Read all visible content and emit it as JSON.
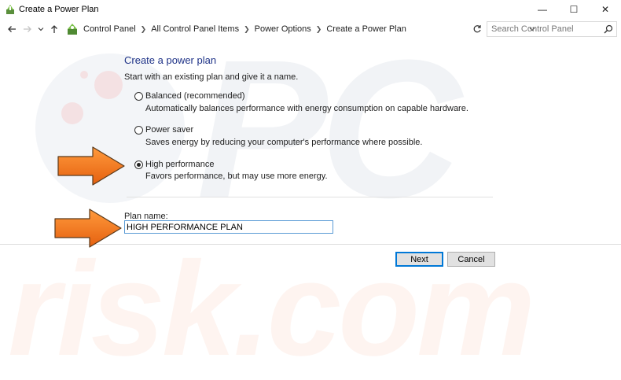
{
  "window": {
    "title": "Create a Power Plan",
    "controls": {
      "minimize": "—",
      "maximize": "☐",
      "close": "✕"
    }
  },
  "nav": {
    "back_icon": "arrow-left-icon",
    "forward_icon": "arrow-right-icon",
    "recent_icon": "chevron-down-icon",
    "up_icon": "arrow-up-icon",
    "breadcrumbs": [
      "Control Panel",
      "All Control Panel Items",
      "Power Options",
      "Create a Power Plan"
    ],
    "search_placeholder": "Search Control Panel"
  },
  "page": {
    "heading": "Create a power plan",
    "subtitle": "Start with an existing plan and give it a name.",
    "options": [
      {
        "label": "Balanced (recommended)",
        "description": "Automatically balances performance with energy consumption on capable hardware.",
        "checked": false
      },
      {
        "label": "Power saver",
        "description": "Saves energy by reducing your computer's performance where possible.",
        "checked": false
      },
      {
        "label": "High performance",
        "description": "Favors performance, but may use more energy.",
        "checked": true
      }
    ],
    "plan_name_label": "Plan name:",
    "plan_name_value": "HIGH PERFORMANCE PLAN",
    "next_label": "Next",
    "cancel_label": "Cancel"
  },
  "watermark": {
    "top": "PC",
    "bottom": "risk.com"
  },
  "colors": {
    "heading": "#1e3287",
    "arrow": "#f47a20",
    "focus": "#0078d7"
  }
}
